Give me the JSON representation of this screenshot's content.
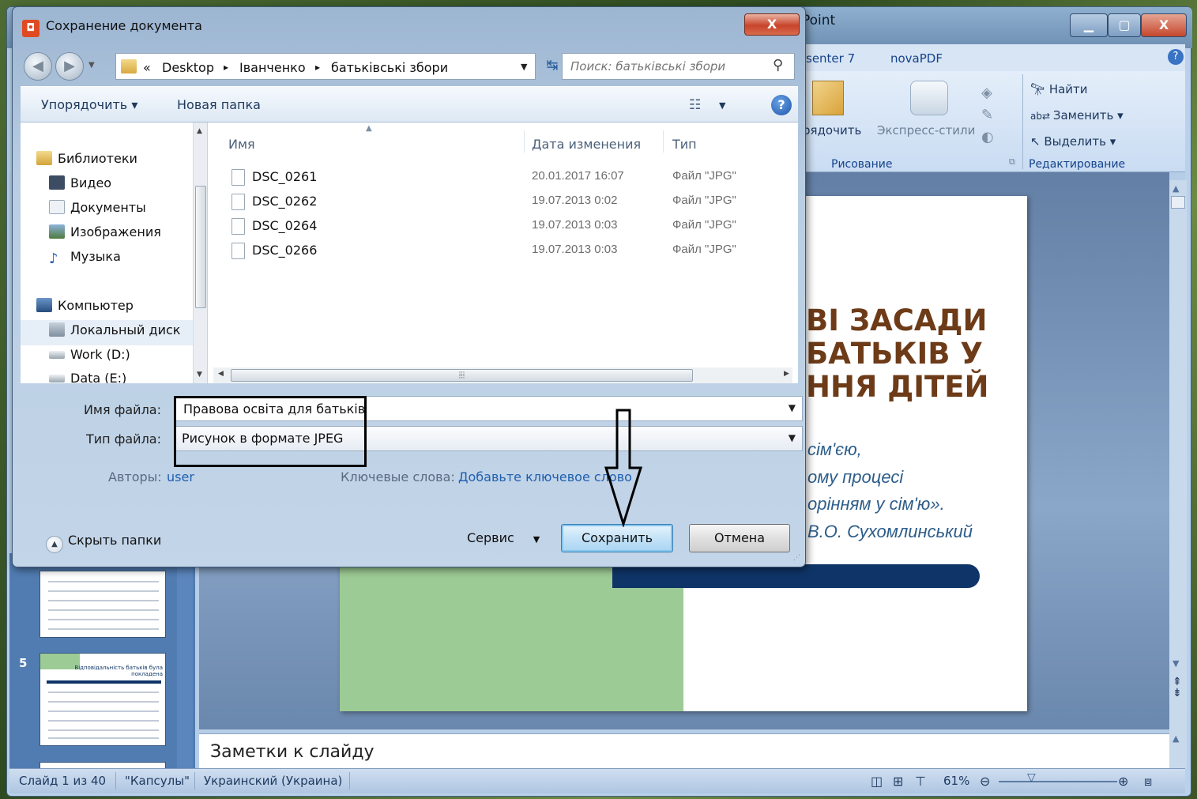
{
  "powerpoint": {
    "title": "Point",
    "ribbon_tabs": [
      "senter 7",
      "novaPDF"
    ],
    "buttons": {
      "arrange": "рядочить",
      "quick_styles": "Экспресс-стили",
      "find": "Найти",
      "replace": "Заменить",
      "select": "Выделить"
    },
    "groups": {
      "drawing": "Рисование",
      "editing": "Редактирование"
    },
    "slide": {
      "title_lines": [
        "ВІ ЗАСАДИ",
        "БАТЬКІВ У",
        "ННЯ ДІТЕЙ"
      ],
      "quote_lines": [
        "сім'єю,",
        "ому процесі",
        "орінням у сім'ю».",
        "В.О. Сухомлинський"
      ]
    },
    "thumbnail_number": "5",
    "thumbnail_caption": "Відповідальність батьків була покладена",
    "notes_placeholder": "Заметки к слайду",
    "status": {
      "slide": "Слайд 1 из 40",
      "theme": "\"Капсулы\"",
      "language": "Украинский (Украина)",
      "zoom": "61%"
    }
  },
  "dialog": {
    "title": "Сохранение документа",
    "close_label": "X",
    "breadcrumbs": [
      "«",
      "Desktop",
      "▸",
      "Іванченко",
      "▸",
      "батьківські збори"
    ],
    "search_placeholder": "Поиск: батьківські збори",
    "toolbar": {
      "organize": "Упорядочить ▾",
      "new_folder": "Новая папка",
      "help": "?"
    },
    "nav": [
      {
        "label": "Библиотеки",
        "icon": "libraries-icon",
        "color": "#d9a73a"
      },
      {
        "label": "Видео",
        "icon": "video-icon",
        "color": "#3c4d63"
      },
      {
        "label": "Документы",
        "icon": "documents-icon",
        "color": "#c9d3de"
      },
      {
        "label": "Изображения",
        "icon": "images-icon",
        "color": "#5b86b7"
      },
      {
        "label": "Музыка",
        "icon": "music-icon",
        "color": "#2f63b4"
      },
      {
        "label": "Компьютер",
        "icon": "computer-icon",
        "color": "#3a5f95"
      },
      {
        "label": "Локальный диск",
        "icon": "local-disk-icon",
        "color": "#7f8f9e"
      },
      {
        "label": "Work (D:)",
        "icon": "drive-icon",
        "color": "#9aa5af"
      },
      {
        "label": "Data (E:)",
        "icon": "drive-icon",
        "color": "#9aa5af"
      }
    ],
    "columns": {
      "name": "Имя",
      "date": "Дата изменения",
      "type": "Тип"
    },
    "files": [
      {
        "name": "DSC_0261",
        "date": "20.01.2017 16:07",
        "type": "Файл \"JPG\""
      },
      {
        "name": "DSC_0262",
        "date": "19.07.2013 0:02",
        "type": "Файл \"JPG\""
      },
      {
        "name": "DSC_0264",
        "date": "19.07.2013 0:03",
        "type": "Файл \"JPG\""
      },
      {
        "name": "DSC_0266",
        "date": "19.07.2013 0:03",
        "type": "Файл \"JPG\""
      }
    ],
    "filename_label": "Имя файла:",
    "filename_value": "Правова освіта для батьків",
    "filetype_label": "Тип файла:",
    "filetype_value": "Рисунок в формате JPEG",
    "authors_label": "Авторы:",
    "authors_value": "user",
    "keywords_label": "Ключевые слова:",
    "keywords_value": "Добавьте ключевое слово",
    "hide_folders": "Скрыть папки",
    "service": "Сервис",
    "save": "Сохранить",
    "cancel": "Отмена"
  }
}
